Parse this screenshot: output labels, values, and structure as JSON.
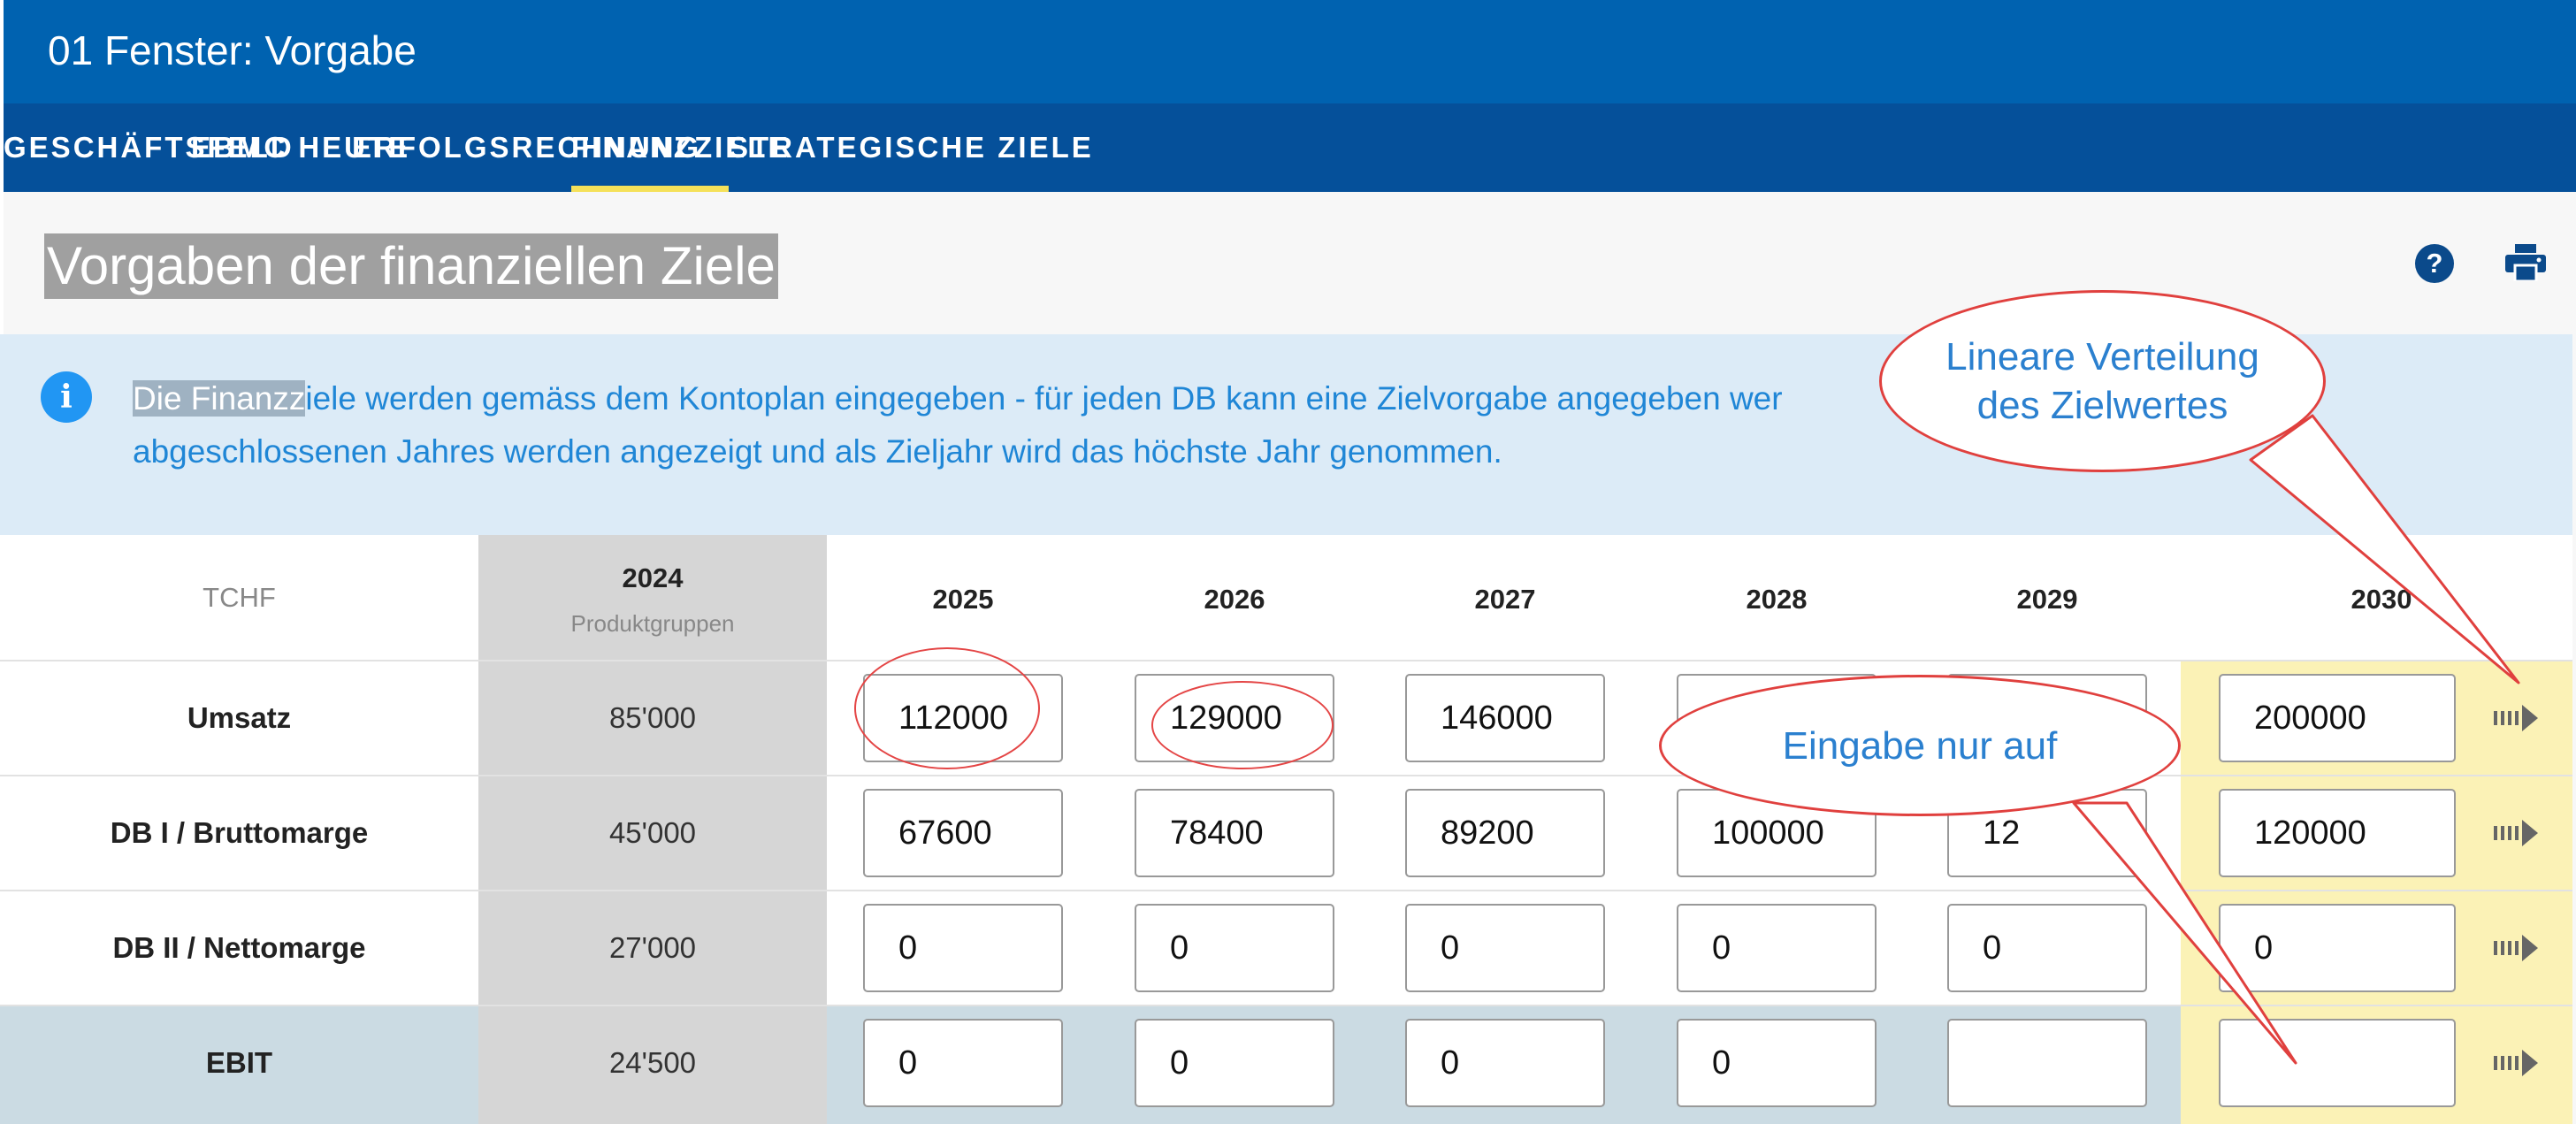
{
  "window": {
    "title": "01 Fenster: Vorgabe"
  },
  "tabs": [
    {
      "label": "GESCHÄFTSFELD"
    },
    {
      "label": "EBMC HEUTE"
    },
    {
      "label": "ERFOLGSRECHNUNG"
    },
    {
      "label": "FINANZZIELE",
      "active": true
    },
    {
      "label": "STRATEGISCHE ZIELE"
    }
  ],
  "page": {
    "title": "Vorgaben der finanziellen Ziele",
    "help_icon": "question-circle-icon",
    "print_icon": "printer-icon"
  },
  "info": {
    "icon": "info-circle-icon",
    "highlight": "Die Finanzz",
    "line1_rest": "iele werden gemäss dem Kontoplan eingegeben - für jeden DB kann eine Zielvorgabe angegeben wer",
    "line2": "abgeschlossenen Jahres werden angezeigt und als Zieljahr wird das höchste Jahr genommen."
  },
  "table": {
    "unit_header": "TCHF",
    "base_year": "2024",
    "base_year_sub": "Produktgruppen",
    "years": [
      "2025",
      "2026",
      "2027",
      "2028",
      "2029",
      "2030"
    ],
    "rows": [
      {
        "label": "Umsatz",
        "base": "85'000",
        "values": [
          "112000",
          "129000",
          "146000",
          "",
          "",
          "200000"
        ]
      },
      {
        "label": "DB I / Bruttomarge",
        "base": "45'000",
        "values": [
          "67600",
          "78400",
          "89200",
          "100000",
          "12",
          "120000"
        ]
      },
      {
        "label": "DB II / Nettomarge",
        "base": "27'000",
        "values": [
          "0",
          "0",
          "0",
          "0",
          "0",
          "0"
        ]
      },
      {
        "label": "EBIT",
        "base": "24'500",
        "values": [
          "0",
          "0",
          "0",
          "0",
          "",
          ""
        ]
      }
    ],
    "row_action_icon": "distribute-arrow-icon"
  },
  "annotations": {
    "callout_top": [
      "Lineare Verteilung",
      "des Zielwertes"
    ],
    "callout_bottom": "Eingabe nur auf"
  },
  "colors": {
    "titlebar": "#0062b0",
    "tabbar": "#05509a",
    "active_tab_underline": "#f5e15a",
    "info_background": "#dcebf7",
    "info_text": "#1f86d6",
    "target_year_column": "#fbf2b6",
    "ebit_row": "#cbdbe3",
    "annotation_red": "#e0403e"
  }
}
